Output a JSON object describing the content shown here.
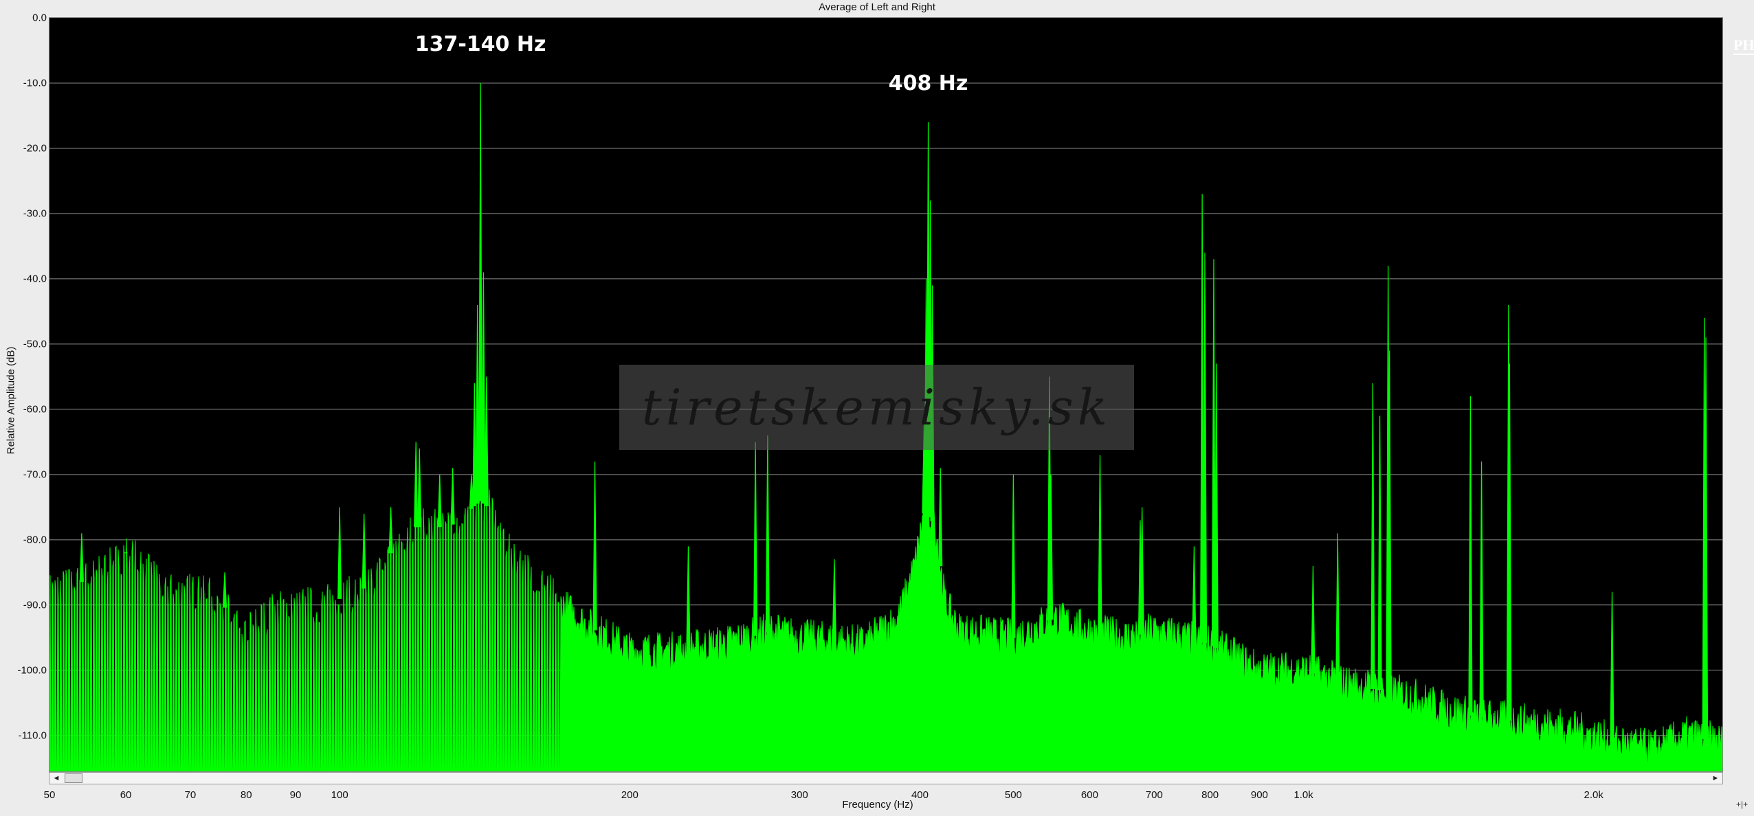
{
  "chart_data": {
    "type": "area",
    "title": "Average of Left and Right",
    "xlabel": "Frequency (Hz)",
    "ylabel": "Relative Amplitude (dB)",
    "x_scale": "log",
    "xlim": [
      50,
      2720
    ],
    "ylim": [
      -115.5,
      0
    ],
    "grid": "horizontal",
    "line_color": "#00ff00",
    "x_ticks": [
      {
        "value": 50,
        "label": "50"
      },
      {
        "value": 60,
        "label": "60"
      },
      {
        "value": 70,
        "label": "70"
      },
      {
        "value": 80,
        "label": "80"
      },
      {
        "value": 90,
        "label": "90"
      },
      {
        "value": 100,
        "label": "100"
      },
      {
        "value": 200,
        "label": "200"
      },
      {
        "value": 300,
        "label": "300"
      },
      {
        "value": 400,
        "label": "400"
      },
      {
        "value": 500,
        "label": "500"
      },
      {
        "value": 600,
        "label": "600"
      },
      {
        "value": 700,
        "label": "700"
      },
      {
        "value": 800,
        "label": "800"
      },
      {
        "value": 900,
        "label": "900"
      },
      {
        "value": 1000,
        "label": "1.0k"
      },
      {
        "value": 2000,
        "label": "2.0k"
      }
    ],
    "y_ticks": [
      {
        "value": 0,
        "label": "0.0"
      },
      {
        "value": -10,
        "label": "-10.0"
      },
      {
        "value": -20,
        "label": "-20.0"
      },
      {
        "value": -30,
        "label": "-30.0"
      },
      {
        "value": -40,
        "label": "-40.0"
      },
      {
        "value": -50,
        "label": "-50.0"
      },
      {
        "value": -60,
        "label": "-60.0"
      },
      {
        "value": -70,
        "label": "-70.0"
      },
      {
        "value": -80,
        "label": "-80.0"
      },
      {
        "value": -90,
        "label": "-90.0"
      },
      {
        "value": -100,
        "label": "-100.0"
      },
      {
        "value": -110,
        "label": "-110.0"
      }
    ],
    "series": [
      {
        "floor": [
          [
            50,
            -88
          ],
          [
            55,
            -86
          ],
          [
            58,
            -84
          ],
          [
            60,
            -82
          ],
          [
            63,
            -84
          ],
          [
            66,
            -88
          ],
          [
            70,
            -88
          ],
          [
            75,
            -89
          ],
          [
            78,
            -93
          ],
          [
            80,
            -94
          ],
          [
            85,
            -91
          ],
          [
            90,
            -90
          ],
          [
            95,
            -90
          ],
          [
            100,
            -89
          ],
          [
            105,
            -88
          ],
          [
            110,
            -85
          ],
          [
            115,
            -80
          ],
          [
            120,
            -78
          ],
          [
            125,
            -78
          ],
          [
            130,
            -78
          ],
          [
            135,
            -76
          ],
          [
            140,
            -74
          ],
          [
            145,
            -76
          ],
          [
            150,
            -82
          ],
          [
            160,
            -86
          ],
          [
            170,
            -90
          ],
          [
            180,
            -93
          ],
          [
            190,
            -95
          ],
          [
            200,
            -97
          ],
          [
            220,
            -97
          ],
          [
            250,
            -96
          ],
          [
            280,
            -94
          ],
          [
            300,
            -95
          ],
          [
            350,
            -96
          ],
          [
            380,
            -92
          ],
          [
            395,
            -84
          ],
          [
            405,
            -75
          ],
          [
            415,
            -78
          ],
          [
            425,
            -90
          ],
          [
            440,
            -94
          ],
          [
            500,
            -95
          ],
          [
            550,
            -92
          ],
          [
            600,
            -94
          ],
          [
            650,
            -95
          ],
          [
            700,
            -94
          ],
          [
            750,
            -95
          ],
          [
            800,
            -96
          ],
          [
            850,
            -98
          ],
          [
            900,
            -100
          ],
          [
            950,
            -100
          ],
          [
            1000,
            -100
          ],
          [
            1100,
            -102
          ],
          [
            1200,
            -103
          ],
          [
            1300,
            -104
          ],
          [
            1400,
            -106
          ],
          [
            1500,
            -107
          ],
          [
            1700,
            -108
          ],
          [
            1900,
            -109
          ],
          [
            2100,
            -111
          ],
          [
            2300,
            -112
          ],
          [
            2500,
            -110
          ],
          [
            2720,
            -111
          ]
        ],
        "peaks": [
          {
            "freq": 54,
            "db": -79
          },
          {
            "freq": 60,
            "db": -82
          },
          {
            "freq": 76,
            "db": -85
          },
          {
            "freq": 100,
            "db": -75
          },
          {
            "freq": 106,
            "db": -76
          },
          {
            "freq": 113,
            "db": -75
          },
          {
            "freq": 120,
            "db": -65
          },
          {
            "freq": 121,
            "db": -66
          },
          {
            "freq": 127,
            "db": -70
          },
          {
            "freq": 131,
            "db": -69
          },
          {
            "freq": 137,
            "db": -70
          },
          {
            "freq": 138,
            "db": -56
          },
          {
            "freq": 139,
            "db": -44
          },
          {
            "freq": 140,
            "db": -10
          },
          {
            "freq": 141,
            "db": -39
          },
          {
            "freq": 142,
            "db": -55
          },
          {
            "freq": 184,
            "db": -68
          },
          {
            "freq": 230,
            "db": -81
          },
          {
            "freq": 270,
            "db": -65
          },
          {
            "freq": 278,
            "db": -64
          },
          {
            "freq": 326,
            "db": -83
          },
          {
            "freq": 404,
            "db": -62
          },
          {
            "freq": 406,
            "db": -40
          },
          {
            "freq": 408,
            "db": -16
          },
          {
            "freq": 410,
            "db": -28
          },
          {
            "freq": 412,
            "db": -41
          },
          {
            "freq": 420,
            "db": -69
          },
          {
            "freq": 500,
            "db": -70
          },
          {
            "freq": 545,
            "db": -55
          },
          {
            "freq": 547,
            "db": -70
          },
          {
            "freq": 615,
            "db": -67
          },
          {
            "freq": 677,
            "db": -77
          },
          {
            "freq": 680,
            "db": -75
          },
          {
            "freq": 770,
            "db": -81
          },
          {
            "freq": 785,
            "db": -27
          },
          {
            "freq": 790,
            "db": -36
          },
          {
            "freq": 807,
            "db": -37
          },
          {
            "freq": 812,
            "db": -53
          },
          {
            "freq": 1023,
            "db": -84
          },
          {
            "freq": 1085,
            "db": -79
          },
          {
            "freq": 1180,
            "db": -56
          },
          {
            "freq": 1200,
            "db": -61
          },
          {
            "freq": 1224,
            "db": -38
          },
          {
            "freq": 1228,
            "db": -51
          },
          {
            "freq": 1490,
            "db": -58
          },
          {
            "freq": 1530,
            "db": -68
          },
          {
            "freq": 1632,
            "db": -44
          },
          {
            "freq": 1636,
            "db": -53
          },
          {
            "freq": 2090,
            "db": -88
          },
          {
            "freq": 2605,
            "db": -46
          },
          {
            "freq": 2615,
            "db": -49
          }
        ]
      }
    ],
    "annotations": [
      {
        "text": "137-140 Hz",
        "freq": 140,
        "db": -6
      },
      {
        "text": "408 Hz",
        "freq": 408,
        "db": -12
      }
    ]
  },
  "watermark": "tiretskemisky.sk",
  "logo_text": "PHS",
  "scrollbar": {
    "left_arrow": "◄",
    "right_arrow": "►"
  },
  "corner_text": "+|+"
}
